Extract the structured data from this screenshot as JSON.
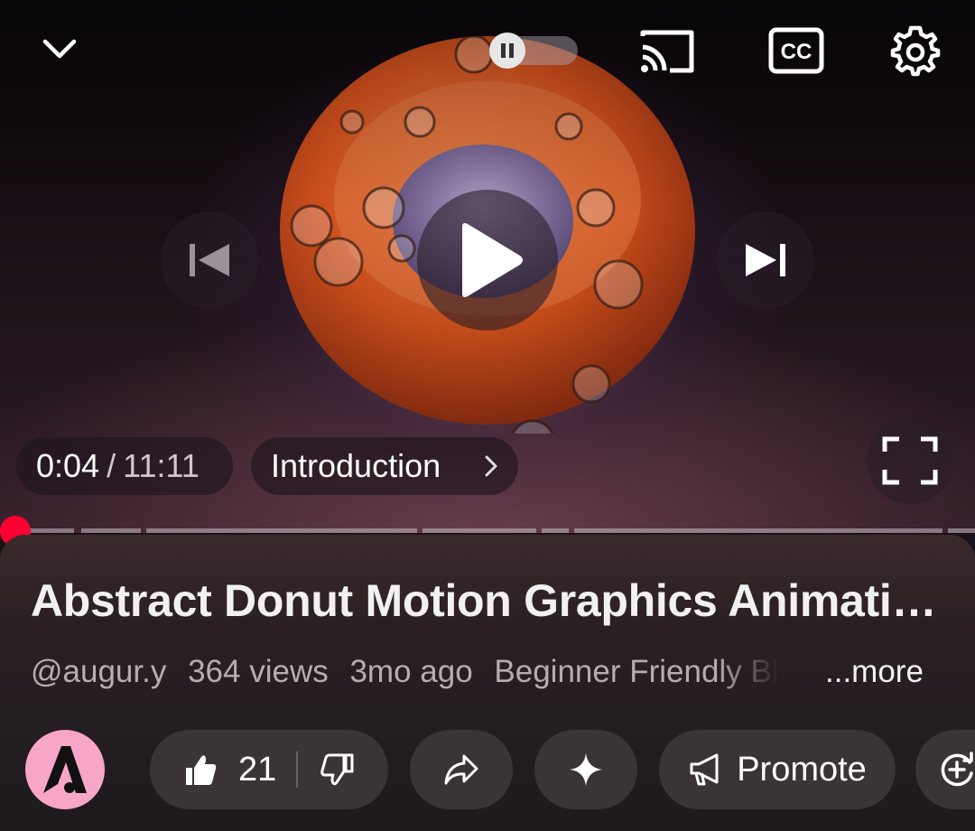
{
  "player": {
    "current_time": "0:04",
    "time_separator": "/",
    "duration": "11:11",
    "chapter": "Introduction",
    "progress_fraction": 0.006,
    "autoplay": "on",
    "colors": {
      "progress": "#ff0033",
      "avatar_bg": "#f7a6c8"
    },
    "icons": [
      "collapse-chevron-down-icon",
      "pause-icon",
      "cast-icon",
      "closed-captions-icon",
      "settings-gear-icon",
      "previous-icon",
      "play-icon",
      "next-icon",
      "fullscreen-icon"
    ]
  },
  "video": {
    "title": "Abstract Donut Motion Graphics Animati…",
    "channel_handle": "@augur.y",
    "views": "364 views",
    "age": "3mo ago",
    "description_preview": "Beginner Friendly Bl",
    "more_label": "...more"
  },
  "actions": {
    "like_count": "21",
    "promote_label": "Promote",
    "icons": [
      "channel-avatar",
      "thumbs-up-icon",
      "thumbs-down-icon",
      "share-icon",
      "remix-sparkle-icon",
      "megaphone-icon",
      "save-to-playlist-icon"
    ]
  }
}
